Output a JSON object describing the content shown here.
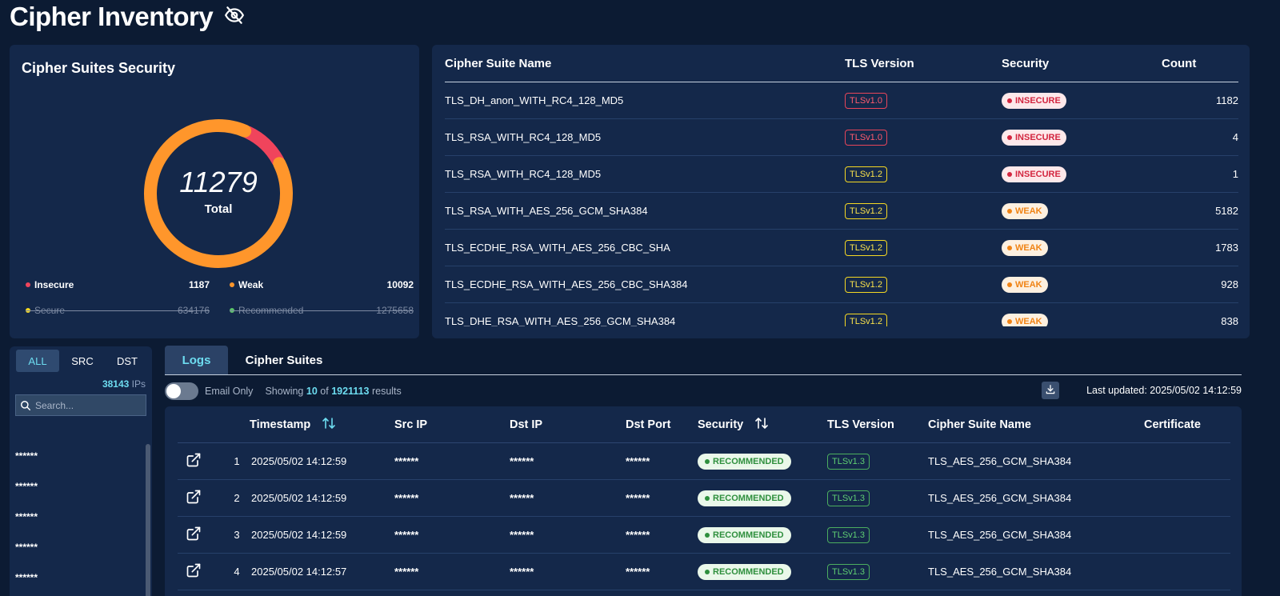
{
  "page": {
    "title": "Cipher Inventory",
    "title_icon": "eye-off-icon"
  },
  "cipher_security": {
    "title": "Cipher Suites Security",
    "total": "11279",
    "total_label": "Total",
    "legend": [
      {
        "label": "Insecure",
        "value": "1187",
        "color": "#f0445c",
        "active": true
      },
      {
        "label": "Weak",
        "value": "10092",
        "color": "#ff962b",
        "active": true
      },
      {
        "label": "Secure",
        "value": "634176",
        "color": "#f5d824",
        "active": false
      },
      {
        "label": "Recommended",
        "value": "1275658",
        "color": "#5cc36a",
        "active": false
      }
    ]
  },
  "chart_data": {
    "type": "pie",
    "categories": [
      "Insecure",
      "Weak"
    ],
    "values": [
      1187,
      10092
    ],
    "colors": [
      "#f0445c",
      "#ff962b"
    ]
  },
  "cipher_table": {
    "headers": [
      "Cipher Suite Name",
      "TLS Version",
      "Security",
      "Count"
    ],
    "rows": [
      {
        "name": "TLS_DH_anon_WITH_RC4_128_MD5",
        "tls": "TLSv1.0",
        "tls_color": "red",
        "security": "INSECURE",
        "sec_class": "insecure",
        "count": "1182"
      },
      {
        "name": "TLS_RSA_WITH_RC4_128_MD5",
        "tls": "TLSv1.0",
        "tls_color": "red",
        "security": "INSECURE",
        "sec_class": "insecure",
        "count": "4"
      },
      {
        "name": "TLS_RSA_WITH_RC4_128_MD5",
        "tls": "TLSv1.2",
        "tls_color": "yellow",
        "security": "INSECURE",
        "sec_class": "insecure",
        "count": "1"
      },
      {
        "name": "TLS_RSA_WITH_AES_256_GCM_SHA384",
        "tls": "TLSv1.2",
        "tls_color": "yellow",
        "security": "WEAK",
        "sec_class": "weak",
        "count": "5182"
      },
      {
        "name": "TLS_ECDHE_RSA_WITH_AES_256_CBC_SHA",
        "tls": "TLSv1.2",
        "tls_color": "yellow",
        "security": "WEAK",
        "sec_class": "weak",
        "count": "1783"
      },
      {
        "name": "TLS_ECDHE_RSA_WITH_AES_256_CBC_SHA384",
        "tls": "TLSv1.2",
        "tls_color": "yellow",
        "security": "WEAK",
        "sec_class": "weak",
        "count": "928"
      },
      {
        "name": "TLS_DHE_RSA_WITH_AES_256_GCM_SHA384",
        "tls": "TLSv1.2",
        "tls_color": "yellow",
        "security": "WEAK",
        "sec_class": "weak",
        "count": "838"
      }
    ]
  },
  "ip_panel": {
    "segments": [
      "ALL",
      "SRC",
      "DST"
    ],
    "active_segment": "ALL",
    "ip_count": "38143",
    "ip_suffix": "IPs",
    "search_placeholder": "Search...",
    "items": [
      "******",
      "******",
      "******",
      "******",
      "******"
    ]
  },
  "logs": {
    "tabs": [
      "Logs",
      "Cipher Suites"
    ],
    "active_tab": "Logs",
    "email_only_label": "Email Only",
    "showing_prefix": "Showing",
    "showing_count": "10",
    "showing_of": "of",
    "total_results": "1921113",
    "showing_suffix": "results",
    "last_updated": "Last updated: 2025/05/02 14:12:59",
    "headers": [
      "Timestamp",
      "Src IP",
      "Dst IP",
      "Dst Port",
      "Security",
      "TLS Version",
      "Cipher Suite Name",
      "Certificate"
    ],
    "rows": [
      {
        "index": "1",
        "timestamp": "2025/05/02 14:12:59",
        "src": "******",
        "dst": "******",
        "port": "******",
        "security": "RECOMMENDED",
        "tls": "TLSv1.3",
        "cipher": "TLS_AES_256_GCM_SHA384",
        "certificate": ""
      },
      {
        "index": "2",
        "timestamp": "2025/05/02 14:12:59",
        "src": "******",
        "dst": "******",
        "port": "******",
        "security": "RECOMMENDED",
        "tls": "TLSv1.3",
        "cipher": "TLS_AES_256_GCM_SHA384",
        "certificate": ""
      },
      {
        "index": "3",
        "timestamp": "2025/05/02 14:12:59",
        "src": "******",
        "dst": "******",
        "port": "******",
        "security": "RECOMMENDED",
        "tls": "TLSv1.3",
        "cipher": "TLS_AES_256_GCM_SHA384",
        "certificate": ""
      },
      {
        "index": "4",
        "timestamp": "2025/05/02 14:12:57",
        "src": "******",
        "dst": "******",
        "port": "******",
        "security": "RECOMMENDED",
        "tls": "TLSv1.3",
        "cipher": "TLS_AES_256_GCM_SHA384",
        "certificate": ""
      }
    ]
  }
}
